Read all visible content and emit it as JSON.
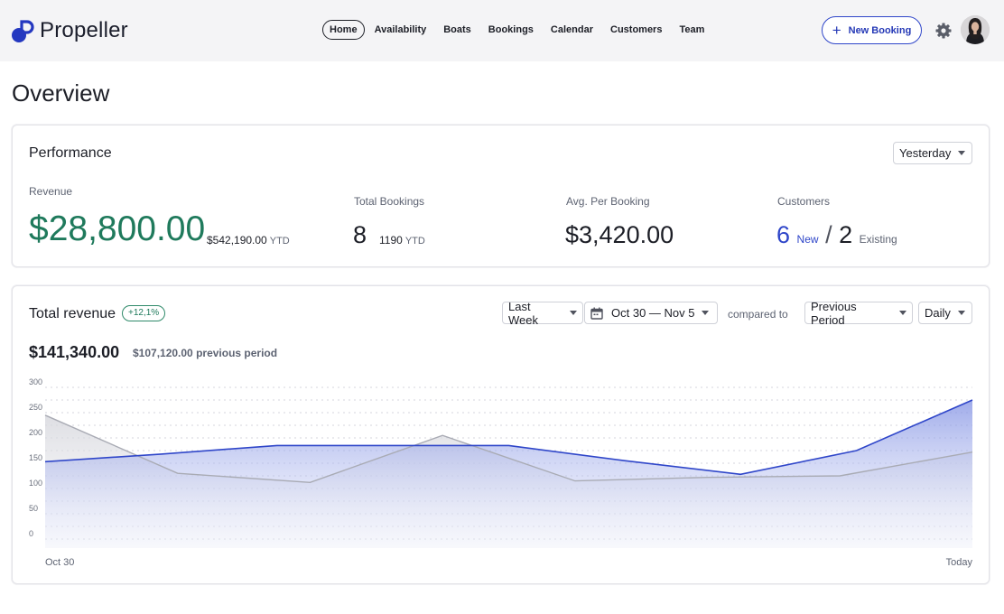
{
  "app": {
    "name": "Propeller"
  },
  "nav": {
    "items": [
      {
        "label": "Home",
        "active": true
      },
      {
        "label": "Availability",
        "active": false
      },
      {
        "label": "Boats",
        "active": false
      },
      {
        "label": "Bookings",
        "active": false
      },
      {
        "label": "Calendar",
        "active": false
      },
      {
        "label": "Customers",
        "active": false
      },
      {
        "label": "Team",
        "active": false
      }
    ],
    "new_booking_label": "New Booking",
    "new_booking_icon": "plus-icon",
    "settings_icon": "gear-icon"
  },
  "page": {
    "title": "Overview"
  },
  "performance": {
    "title": "Performance",
    "period": "Yesterday",
    "revenue": {
      "label": "Revenue",
      "value": "$28,800.00",
      "ytd_value": "$542,190.00",
      "ytd_label": "YTD"
    },
    "bookings": {
      "label": "Total Bookings",
      "value": "8",
      "ytd_value": "1190",
      "ytd_label": "YTD"
    },
    "avg": {
      "label": "Avg. Per Booking",
      "value": "$3,420.00"
    },
    "customers": {
      "label": "Customers",
      "new_value": "6",
      "new_label": "New",
      "separator": "/",
      "existing_value": "2",
      "existing_label": "Existing"
    }
  },
  "total_revenue": {
    "title": "Total revenue",
    "badge": "+12,1%",
    "range_select": "Last Week",
    "date_range": "Oct 30 — Nov 5",
    "compared_label": "compared to",
    "compare_select": "Previous Period",
    "granularity_select": "Daily",
    "total": "$141,340.00",
    "previous": "$107,120.00 previous period"
  },
  "colors": {
    "accent": "#2f46c9",
    "positive": "#1f7a5c",
    "previous_series": "#a9abb4"
  },
  "chart_data": {
    "type": "area",
    "x_labels": [
      "Oct 30",
      "Today"
    ],
    "yticks": [
      0,
      50,
      100,
      150,
      200,
      250,
      300
    ],
    "ylim": [
      0,
      300
    ],
    "grid": true,
    "series": [
      {
        "values": [
          153,
          168,
          185,
          185,
          185,
          155,
          128,
          175,
          275
        ]
      },
      {
        "values": [
          245,
          130,
          112,
          205,
          115,
          122,
          125,
          172
        ]
      }
    ]
  }
}
